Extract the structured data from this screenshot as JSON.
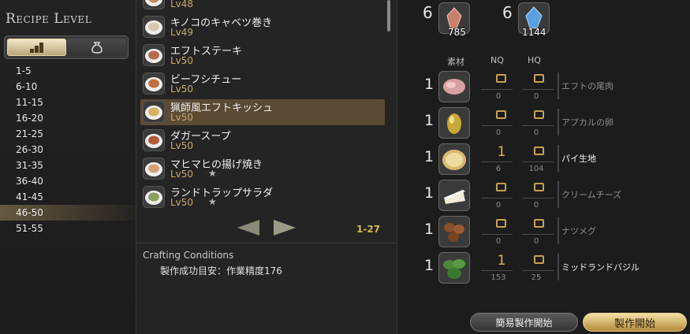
{
  "left": {
    "title": "Recipe Level",
    "levels": [
      "1-5",
      "6-10",
      "11-15",
      "16-20",
      "21-25",
      "26-30",
      "31-35",
      "36-40",
      "41-45",
      "46-50",
      "51-55"
    ],
    "selected_level": "46-50"
  },
  "recipes": [
    {
      "name": "",
      "lv": "Lv48",
      "star": false
    },
    {
      "name": "キノコのキャベツ巻き",
      "lv": "Lv49",
      "star": false
    },
    {
      "name": "エフトステーキ",
      "lv": "Lv50",
      "star": false
    },
    {
      "name": "ビーフシチュー",
      "lv": "Lv50",
      "star": false
    },
    {
      "name": "猟師風エフトキッシュ",
      "lv": "Lv50",
      "star": false,
      "selected": true
    },
    {
      "name": "ダガースープ",
      "lv": "Lv50",
      "star": false
    },
    {
      "name": "マヒマヒの揚げ焼き",
      "lv": "Lv50",
      "star": true
    },
    {
      "name": "ランドトラップサラダ",
      "lv": "Lv50",
      "star": true
    }
  ],
  "star_glyph": "★",
  "pager": "1-27",
  "conditions": {
    "title": "Crafting Conditions",
    "line": "製作成功目安：作業精度176"
  },
  "crystals": [
    {
      "required": "6",
      "owned": "785",
      "color": "#c9806a"
    },
    {
      "required": "6",
      "owned": "1144",
      "color": "#5a9fe0"
    }
  ],
  "headers": {
    "material": "素材",
    "nq": "NQ",
    "hq": "HQ"
  },
  "materials": [
    {
      "qty": "1",
      "name": "エフトの尾肉",
      "nq_sel": "",
      "hq_sel": "",
      "nq_have": "0",
      "hq_have": "0",
      "ok": false,
      "icon": "meat-icon"
    },
    {
      "qty": "1",
      "name": "アプカルの卵",
      "nq_sel": "",
      "hq_sel": "",
      "nq_have": "0",
      "hq_have": "0",
      "ok": false,
      "icon": "egg-icon"
    },
    {
      "qty": "1",
      "name": "パイ生地",
      "nq_sel": "1",
      "hq_sel": "",
      "nq_have": "6",
      "hq_have": "104",
      "ok": true,
      "icon": "pie-crust-icon"
    },
    {
      "qty": "1",
      "name": "クリームチーズ",
      "nq_sel": "",
      "hq_sel": "",
      "nq_have": "0",
      "hq_have": "0",
      "ok": false,
      "icon": "cheese-icon"
    },
    {
      "qty": "1",
      "name": "ナツメグ",
      "nq_sel": "",
      "hq_sel": "",
      "nq_have": "0",
      "hq_have": "0",
      "ok": false,
      "icon": "nutmeg-icon"
    },
    {
      "qty": "1",
      "name": "ミッドランドバジル",
      "nq_sel": "1",
      "hq_sel": "",
      "nq_have": "153",
      "hq_have": "25",
      "ok": true,
      "icon": "basil-icon"
    }
  ],
  "buttons": {
    "quick": "簡易製作開始",
    "start": "製作開始"
  }
}
